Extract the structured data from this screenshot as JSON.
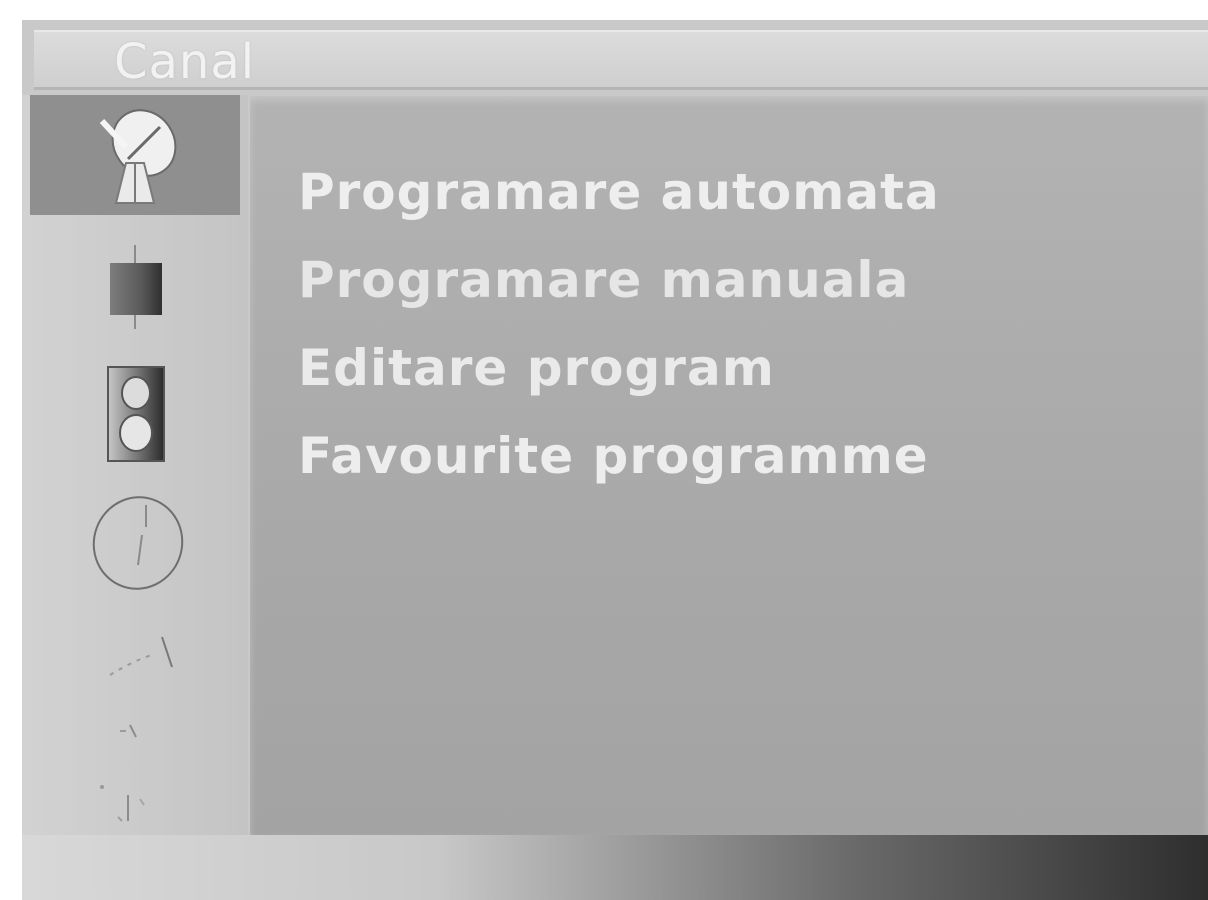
{
  "window": {
    "title": "Canal"
  },
  "sidebar": {
    "items": [
      {
        "id": "canal",
        "icon": "satellite-dish-icon",
        "selected": true
      },
      {
        "id": "image",
        "icon": "picture-icon",
        "selected": false
      },
      {
        "id": "sound",
        "icon": "speaker-icon",
        "selected": false
      },
      {
        "id": "time",
        "icon": "clock-icon",
        "selected": false
      },
      {
        "id": "special",
        "icon": "special-icon",
        "selected": false
      },
      {
        "id": "screen",
        "icon": "screen-icon",
        "selected": false
      },
      {
        "id": "settings",
        "icon": "settings-icon",
        "selected": false
      }
    ]
  },
  "menu": {
    "items": [
      {
        "label": "Programare automata"
      },
      {
        "label": "Programare manuala"
      },
      {
        "label": "Editare program"
      },
      {
        "label": "Favourite programme"
      }
    ]
  },
  "colors": {
    "panel": "#a8a8a8",
    "sidebar": "#c8c8c8",
    "selected": "#8f8f8f",
    "text": "#eeeeee"
  }
}
